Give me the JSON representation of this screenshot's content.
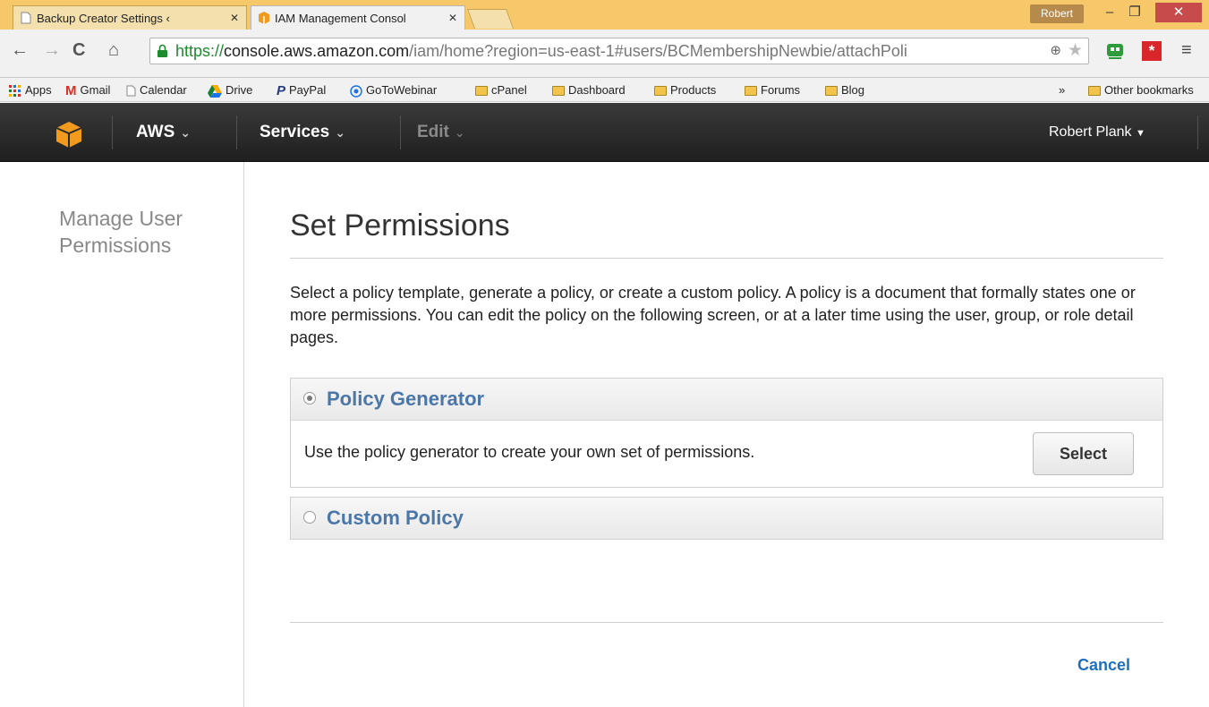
{
  "browser": {
    "tabs": [
      {
        "label": "Backup Creator Settings ‹",
        "active": false
      },
      {
        "label": "IAM Management Consol",
        "active": true
      }
    ],
    "profile": "Robert",
    "url_scheme": "https://",
    "url_host": "console.aws.amazon.com",
    "url_path": "/iam/home?region=us-east-1#users/BCMembershipNewbie/attachPoli",
    "bookmarks": [
      "Apps",
      "Gmail",
      "Calendar",
      "Drive",
      "PayPal",
      "GoToWebinar",
      "cPanel",
      "Dashboard",
      "Products",
      "Forums",
      "Blog"
    ],
    "overflow": "»",
    "other_bookmarks": "Other bookmarks"
  },
  "aws_header": {
    "aws_label": "AWS",
    "services_label": "Services",
    "edit_label": "Edit",
    "user_label": "Robert Plank"
  },
  "sidebar": {
    "nav_title": "Manage User Permissions"
  },
  "main": {
    "title": "Set Permissions",
    "intro": "Select a policy template, generate a policy, or create a custom policy. A policy is a document that formally states one or more permissions. You can edit the policy on the following screen, or at a later time using the user, group, or role detail pages.",
    "options": [
      {
        "label": "Policy Generator",
        "selected": true,
        "description": "Use the policy generator to create your own set of permissions.",
        "button": "Select"
      },
      {
        "label": "Custom Policy",
        "selected": false
      }
    ],
    "cancel_label": "Cancel"
  },
  "colors": {
    "tabstrip": "#f7c86a",
    "aws_bar": "#2b2b2b",
    "option_label": "#4b77a8",
    "cancel_link": "#1f6fbf",
    "https_green": "#1d8a2e"
  }
}
